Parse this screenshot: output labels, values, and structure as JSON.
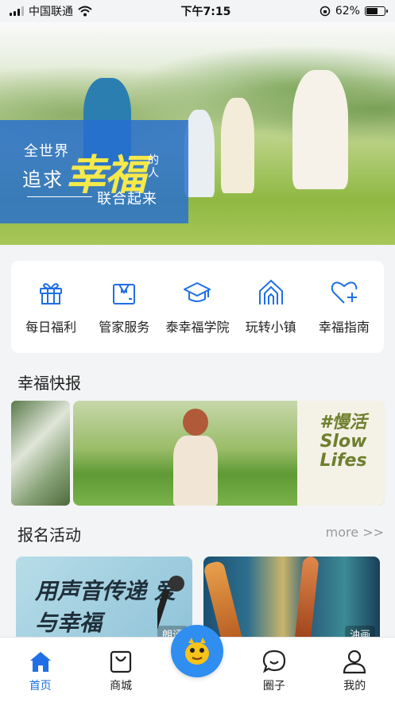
{
  "status_bar": {
    "carrier": "中国联通",
    "time": "下午7:15",
    "battery_percent": "62%",
    "battery_level": 0.62
  },
  "hero": {
    "line1": "全世界",
    "line2": "追求",
    "highlight": "幸福",
    "small": "的人",
    "line3": "联合起来"
  },
  "quick_menu": [
    {
      "label": "每日福利",
      "icon": "gift-icon"
    },
    {
      "label": "管家服务",
      "icon": "butler-icon"
    },
    {
      "label": "泰幸福学院",
      "icon": "graduation-cap-icon"
    },
    {
      "label": "玩转小镇",
      "icon": "town-arch-icon"
    },
    {
      "label": "幸福指南",
      "icon": "heart-plus-icon"
    }
  ],
  "news": {
    "title": "幸福快报",
    "banner_text": "#慢活 Slow Lifes"
  },
  "activities": {
    "title": "报名活动",
    "more": "more >>",
    "cards": [
      {
        "calligraphy": "用声音传递 爱与幸福",
        "tag": "朗诵"
      },
      {
        "tag": "油画"
      }
    ]
  },
  "tab_bar": {
    "items": [
      {
        "label": "首页",
        "icon": "home-icon",
        "active": true
      },
      {
        "label": "商城",
        "icon": "shopping-bag-icon",
        "active": false
      },
      {
        "label": "圈子",
        "icon": "chat-bubble-icon",
        "active": false
      },
      {
        "label": "我的",
        "icon": "user-icon",
        "active": false
      }
    ]
  },
  "colors": {
    "accent": "#1f6fe6",
    "center_button": "#2f8ef0",
    "hero_banner": "#266ed2",
    "highlight": "#f6e94a"
  }
}
